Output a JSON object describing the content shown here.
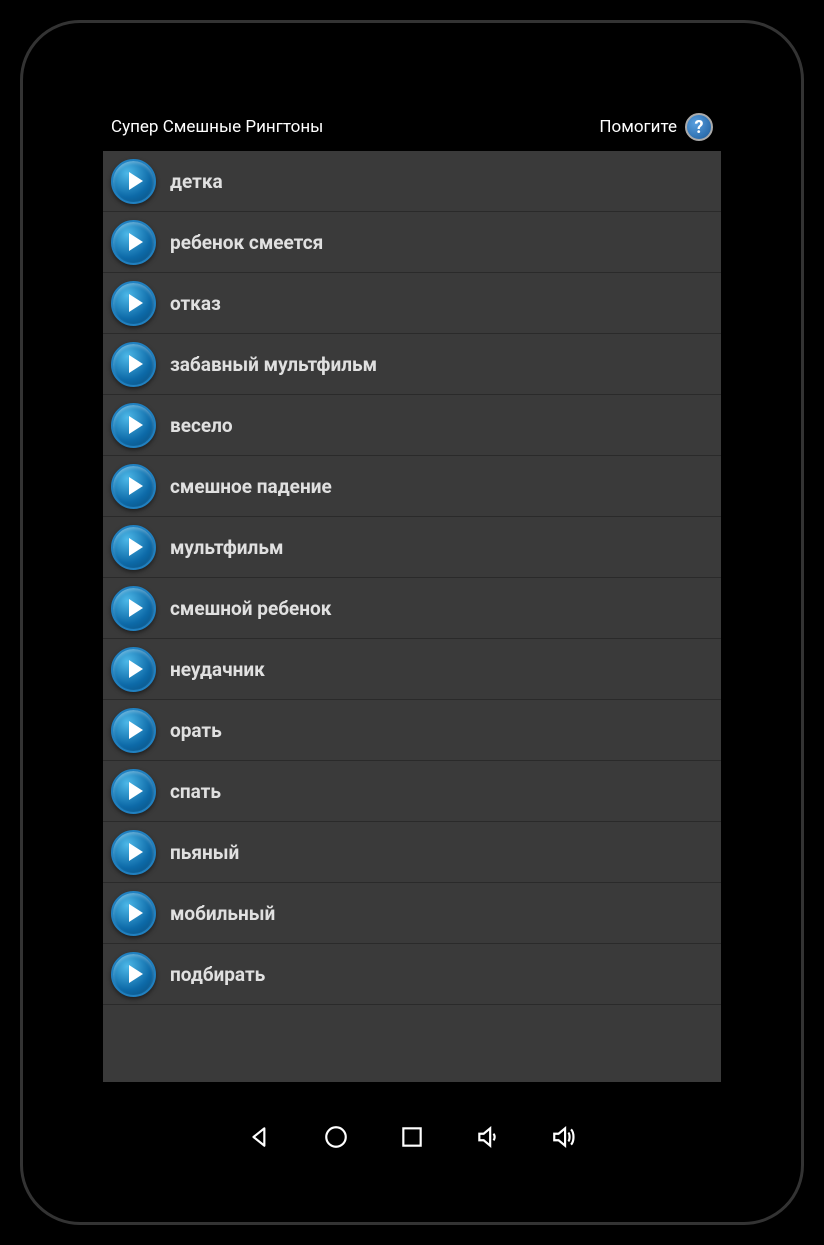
{
  "header": {
    "title": "Супер Смешные Рингтоны",
    "help_label": "Помогите"
  },
  "ringtones": [
    {
      "label": "детка"
    },
    {
      "label": "ребенок смеется"
    },
    {
      "label": "отказ"
    },
    {
      "label": "забавный мультфильм"
    },
    {
      "label": "весело"
    },
    {
      "label": "смешное падение"
    },
    {
      "label": "мультфильм"
    },
    {
      "label": "смешной ребенок"
    },
    {
      "label": "неудачник"
    },
    {
      "label": "орать"
    },
    {
      "label": "спать"
    },
    {
      "label": "пьяный"
    },
    {
      "label": "мобильный"
    },
    {
      "label": "подбирать"
    }
  ]
}
